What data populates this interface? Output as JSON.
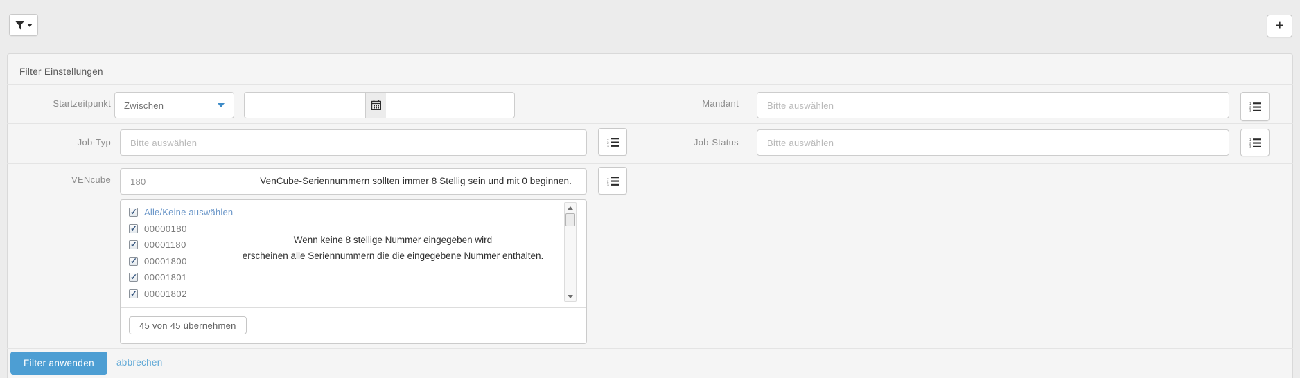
{
  "toolbar": {
    "add_button_label": "+"
  },
  "panel": {
    "title": "Filter Einstellungen"
  },
  "fields": {
    "startzeitpunkt": {
      "label": "Startzeitpunkt",
      "operator": "Zwischen",
      "from_value": "",
      "to_value": ""
    },
    "mandant": {
      "label": "Mandant",
      "placeholder": "Bitte auswählen"
    },
    "job_typ": {
      "label": "Job-Typ",
      "placeholder": "Bitte auswählen"
    },
    "job_status": {
      "label": "Job-Status",
      "placeholder": "Bitte auswählen"
    },
    "vencube": {
      "label": "VENcube",
      "value": "180",
      "hint": "VenCube-Seriennummern sollten immer 8 Stellig sein und mit 0 beginnen.",
      "select_all_label": "Alle/Keine auswählen",
      "select_all_checked": true,
      "options": [
        {
          "label": "00000180",
          "checked": true
        },
        {
          "label": "00001180",
          "checked": true
        },
        {
          "label": "00001800",
          "checked": true
        },
        {
          "label": "00001801",
          "checked": true
        },
        {
          "label": "00001802",
          "checked": true
        }
      ],
      "overlay_line1": "Wenn keine 8 stellige Nummer eingegeben wird",
      "overlay_line2": "erscheinen alle Seriennummern die die eingegebene Nummer enthalten.",
      "apply_count_label": "45 von 45 übernehmen"
    }
  },
  "footer": {
    "apply_label": "Filter anwenden",
    "cancel_label": "abbrechen"
  },
  "colors": {
    "accent_blue": "#4d9ed3",
    "link_blue": "#6a96c8",
    "caret_blue": "#3d8bc7"
  }
}
